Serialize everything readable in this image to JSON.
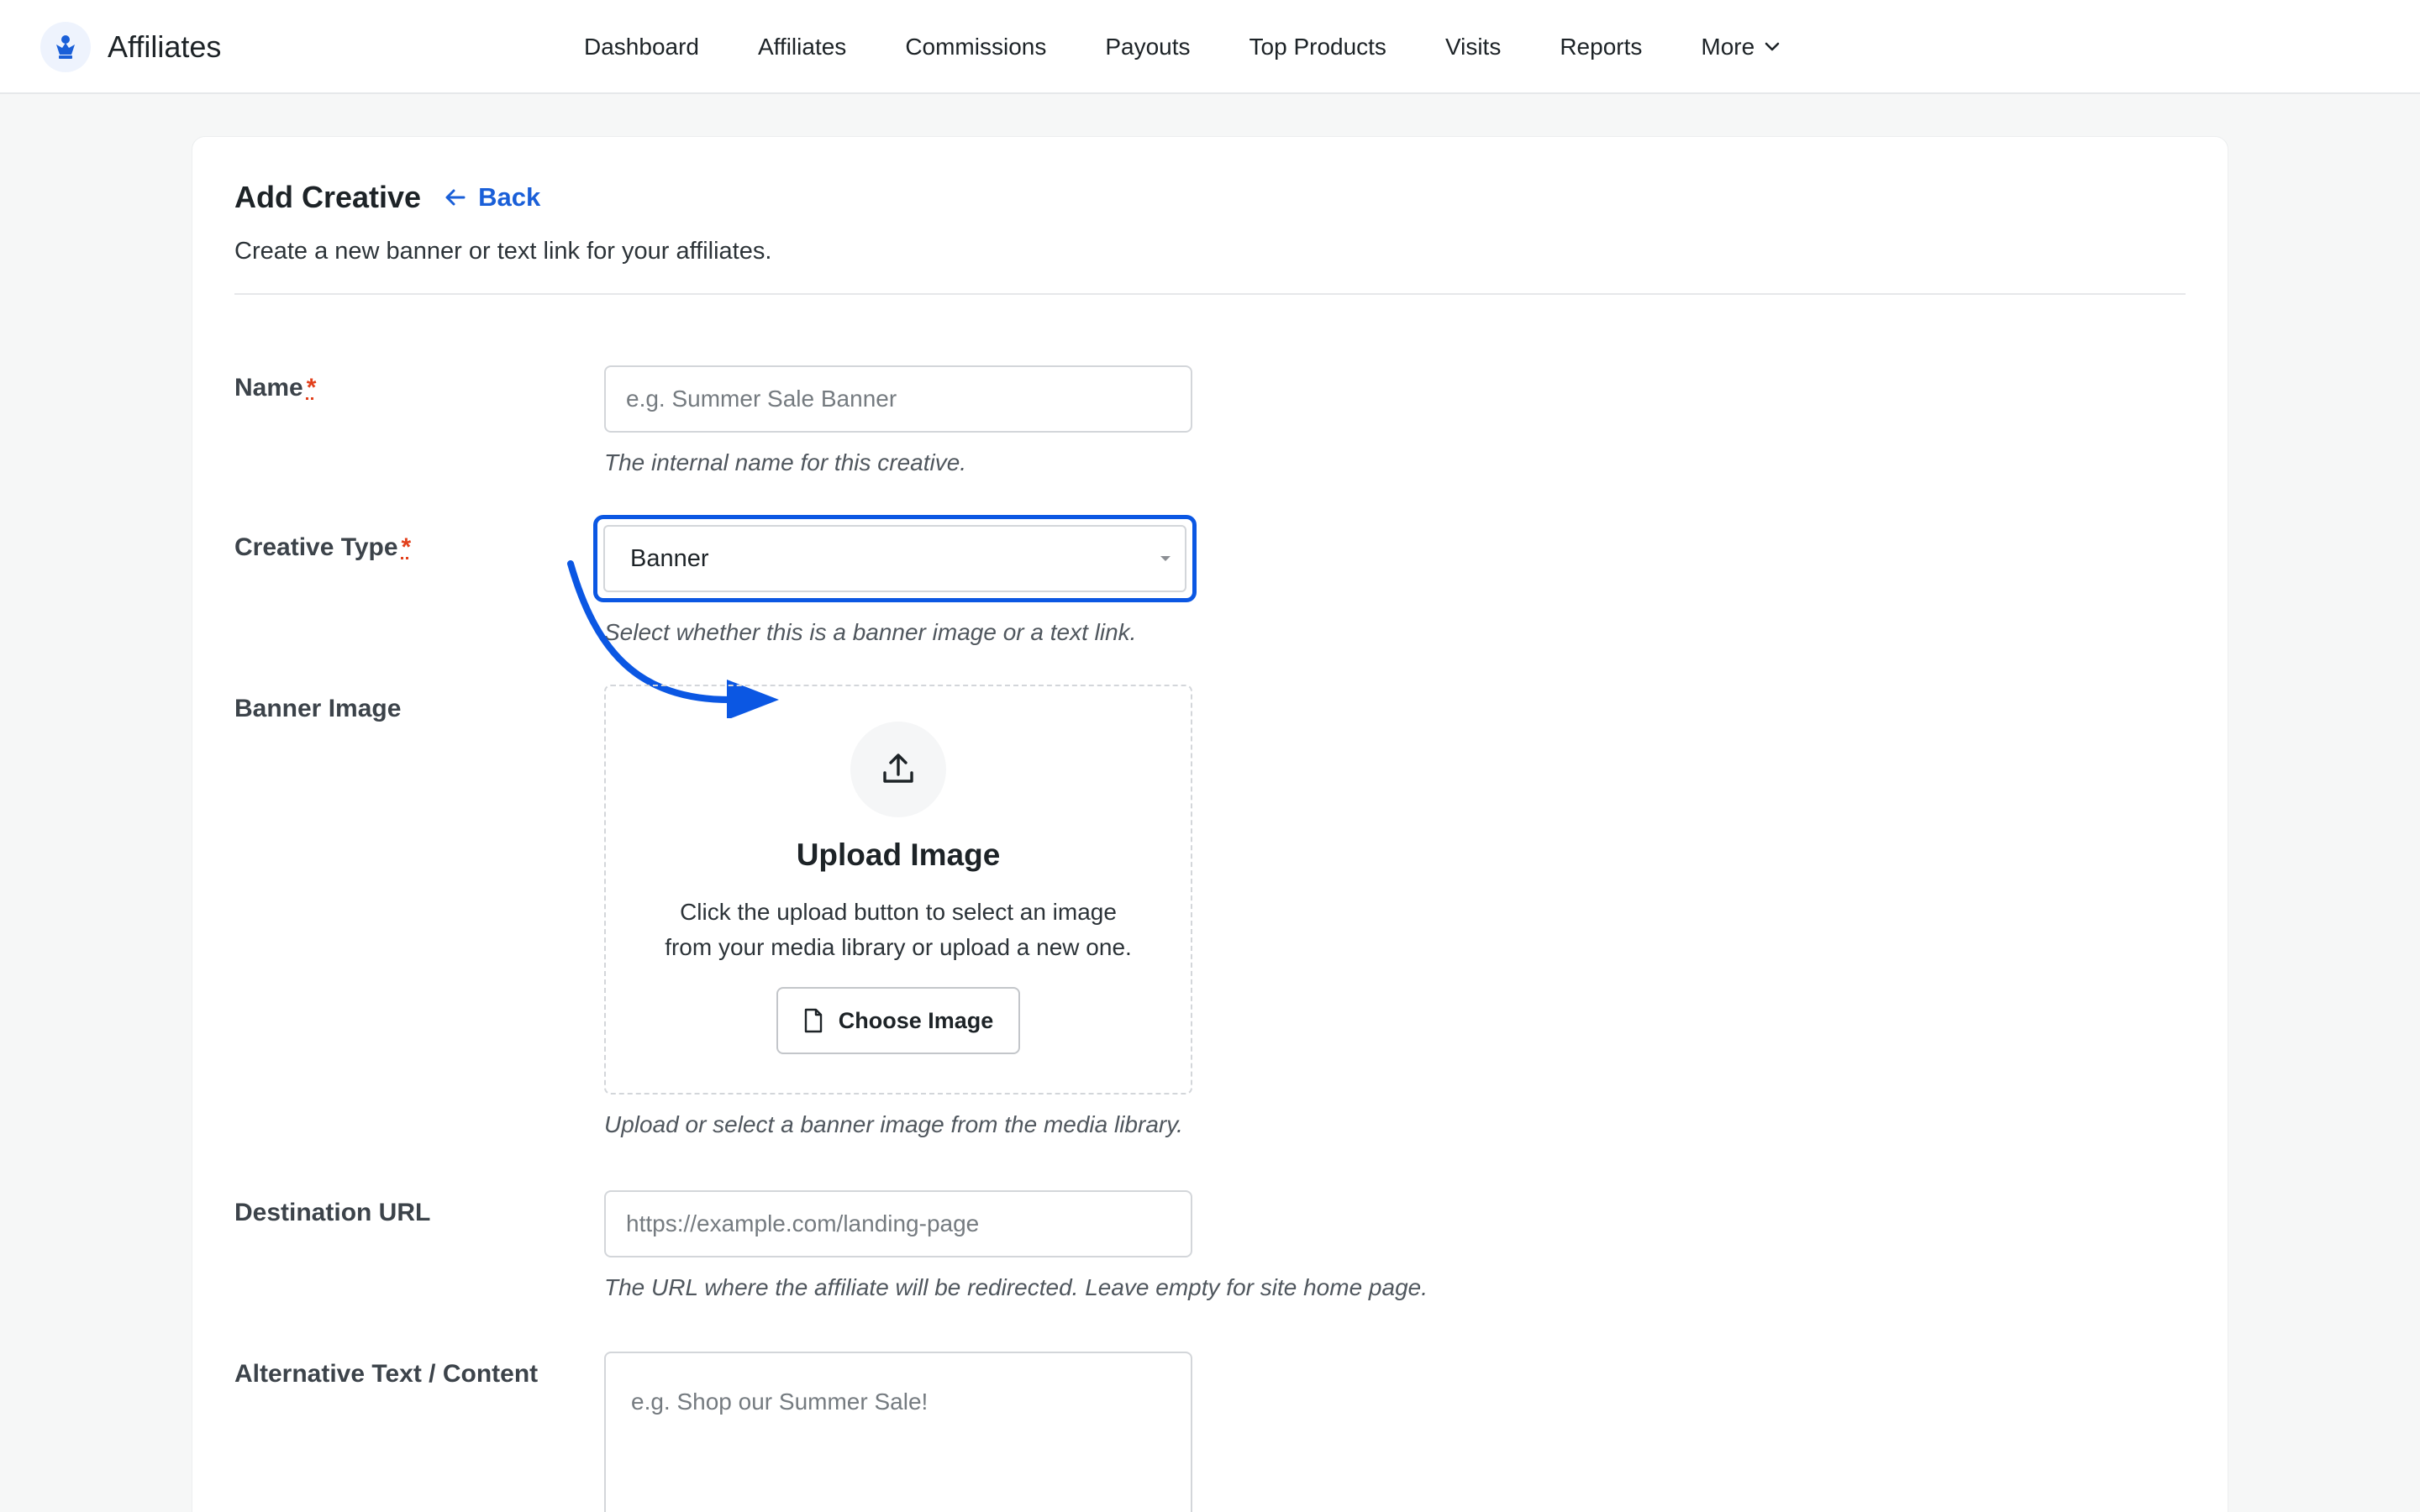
{
  "brand": {
    "name": "Affiliates",
    "logo_icon": "affiliates-logo-icon"
  },
  "nav": {
    "items": [
      "Dashboard",
      "Affiliates",
      "Commissions",
      "Payouts",
      "Top Products",
      "Visits",
      "Reports"
    ],
    "more_label": "More"
  },
  "header": {
    "title": "Add Creative",
    "back_label": "Back",
    "subtitle": "Create a new banner or text link for your affiliates."
  },
  "form": {
    "name": {
      "label": "Name",
      "required_mark": "*",
      "placeholder": "e.g. Summer Sale Banner",
      "help": "The internal name for this creative."
    },
    "creative_type": {
      "label": "Creative Type",
      "required_mark": "*",
      "value": "Banner",
      "help": "Select whether this is a banner image or a text link."
    },
    "banner_image": {
      "label": "Banner Image",
      "upload_title": "Upload Image",
      "upload_desc_line1": "Click the upload button to select an image",
      "upload_desc_line2": "from your media library or upload a new one.",
      "button_label": "Choose Image",
      "help": "Upload or select a banner image from the media library."
    },
    "destination_url": {
      "label": "Destination URL",
      "placeholder": "https://example.com/landing-page",
      "help": "The URL where the affiliate will be redirected. Leave empty for site home page."
    },
    "alt_text": {
      "label": "Alternative Text / Content",
      "placeholder": "e.g. Shop our Summer Sale!"
    }
  },
  "colors": {
    "accent": "#0b57e3",
    "link": "#1a5fd8",
    "required": "#e2401c"
  }
}
